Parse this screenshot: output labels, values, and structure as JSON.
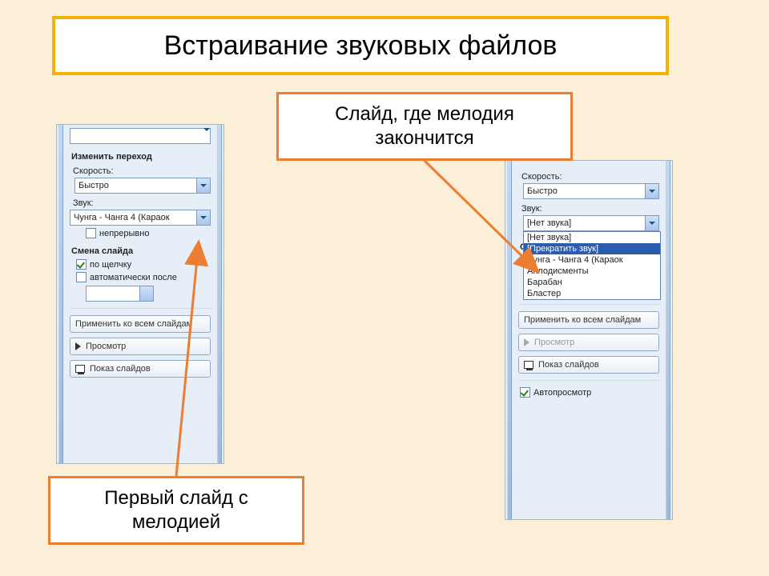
{
  "title": "Встраивание звуковых файлов",
  "callouts": {
    "top": "Слайд, где мелодия закончится",
    "bottom": "Первый слайд с мелодией"
  },
  "panels": {
    "left": {
      "transition_header": "Изменить переход",
      "speed_label": "Скорость:",
      "speed_value": "Быстро",
      "sound_label": "Звук:",
      "sound_value": "Чунга - Чанга 4 (Караок",
      "loop_label": "непрерывно",
      "advance_header": "Смена слайда",
      "on_click_label": "по щелчку",
      "auto_after_label": "автоматически после",
      "apply_all": "Применить ко всем слайдам",
      "preview": "Просмотр",
      "slideshow": "Показ слайдов"
    },
    "right": {
      "speed_label": "Скорость:",
      "speed_value": "Быстро",
      "sound_label": "Звук:",
      "sound_value": "[Нет звука]",
      "sound_options": [
        "[Нет звука]",
        "[Прекратить звук]",
        "Чунга - Чанга 4 (Караок",
        "Аплодисменты",
        "Барабан",
        "Бластер"
      ],
      "advance_header_short": "Смен",
      "apply_all": "Применить ко всем слайдам",
      "preview": "Просмотр",
      "slideshow": "Показ слайдов",
      "autopreview": "Автопросмотр"
    }
  }
}
